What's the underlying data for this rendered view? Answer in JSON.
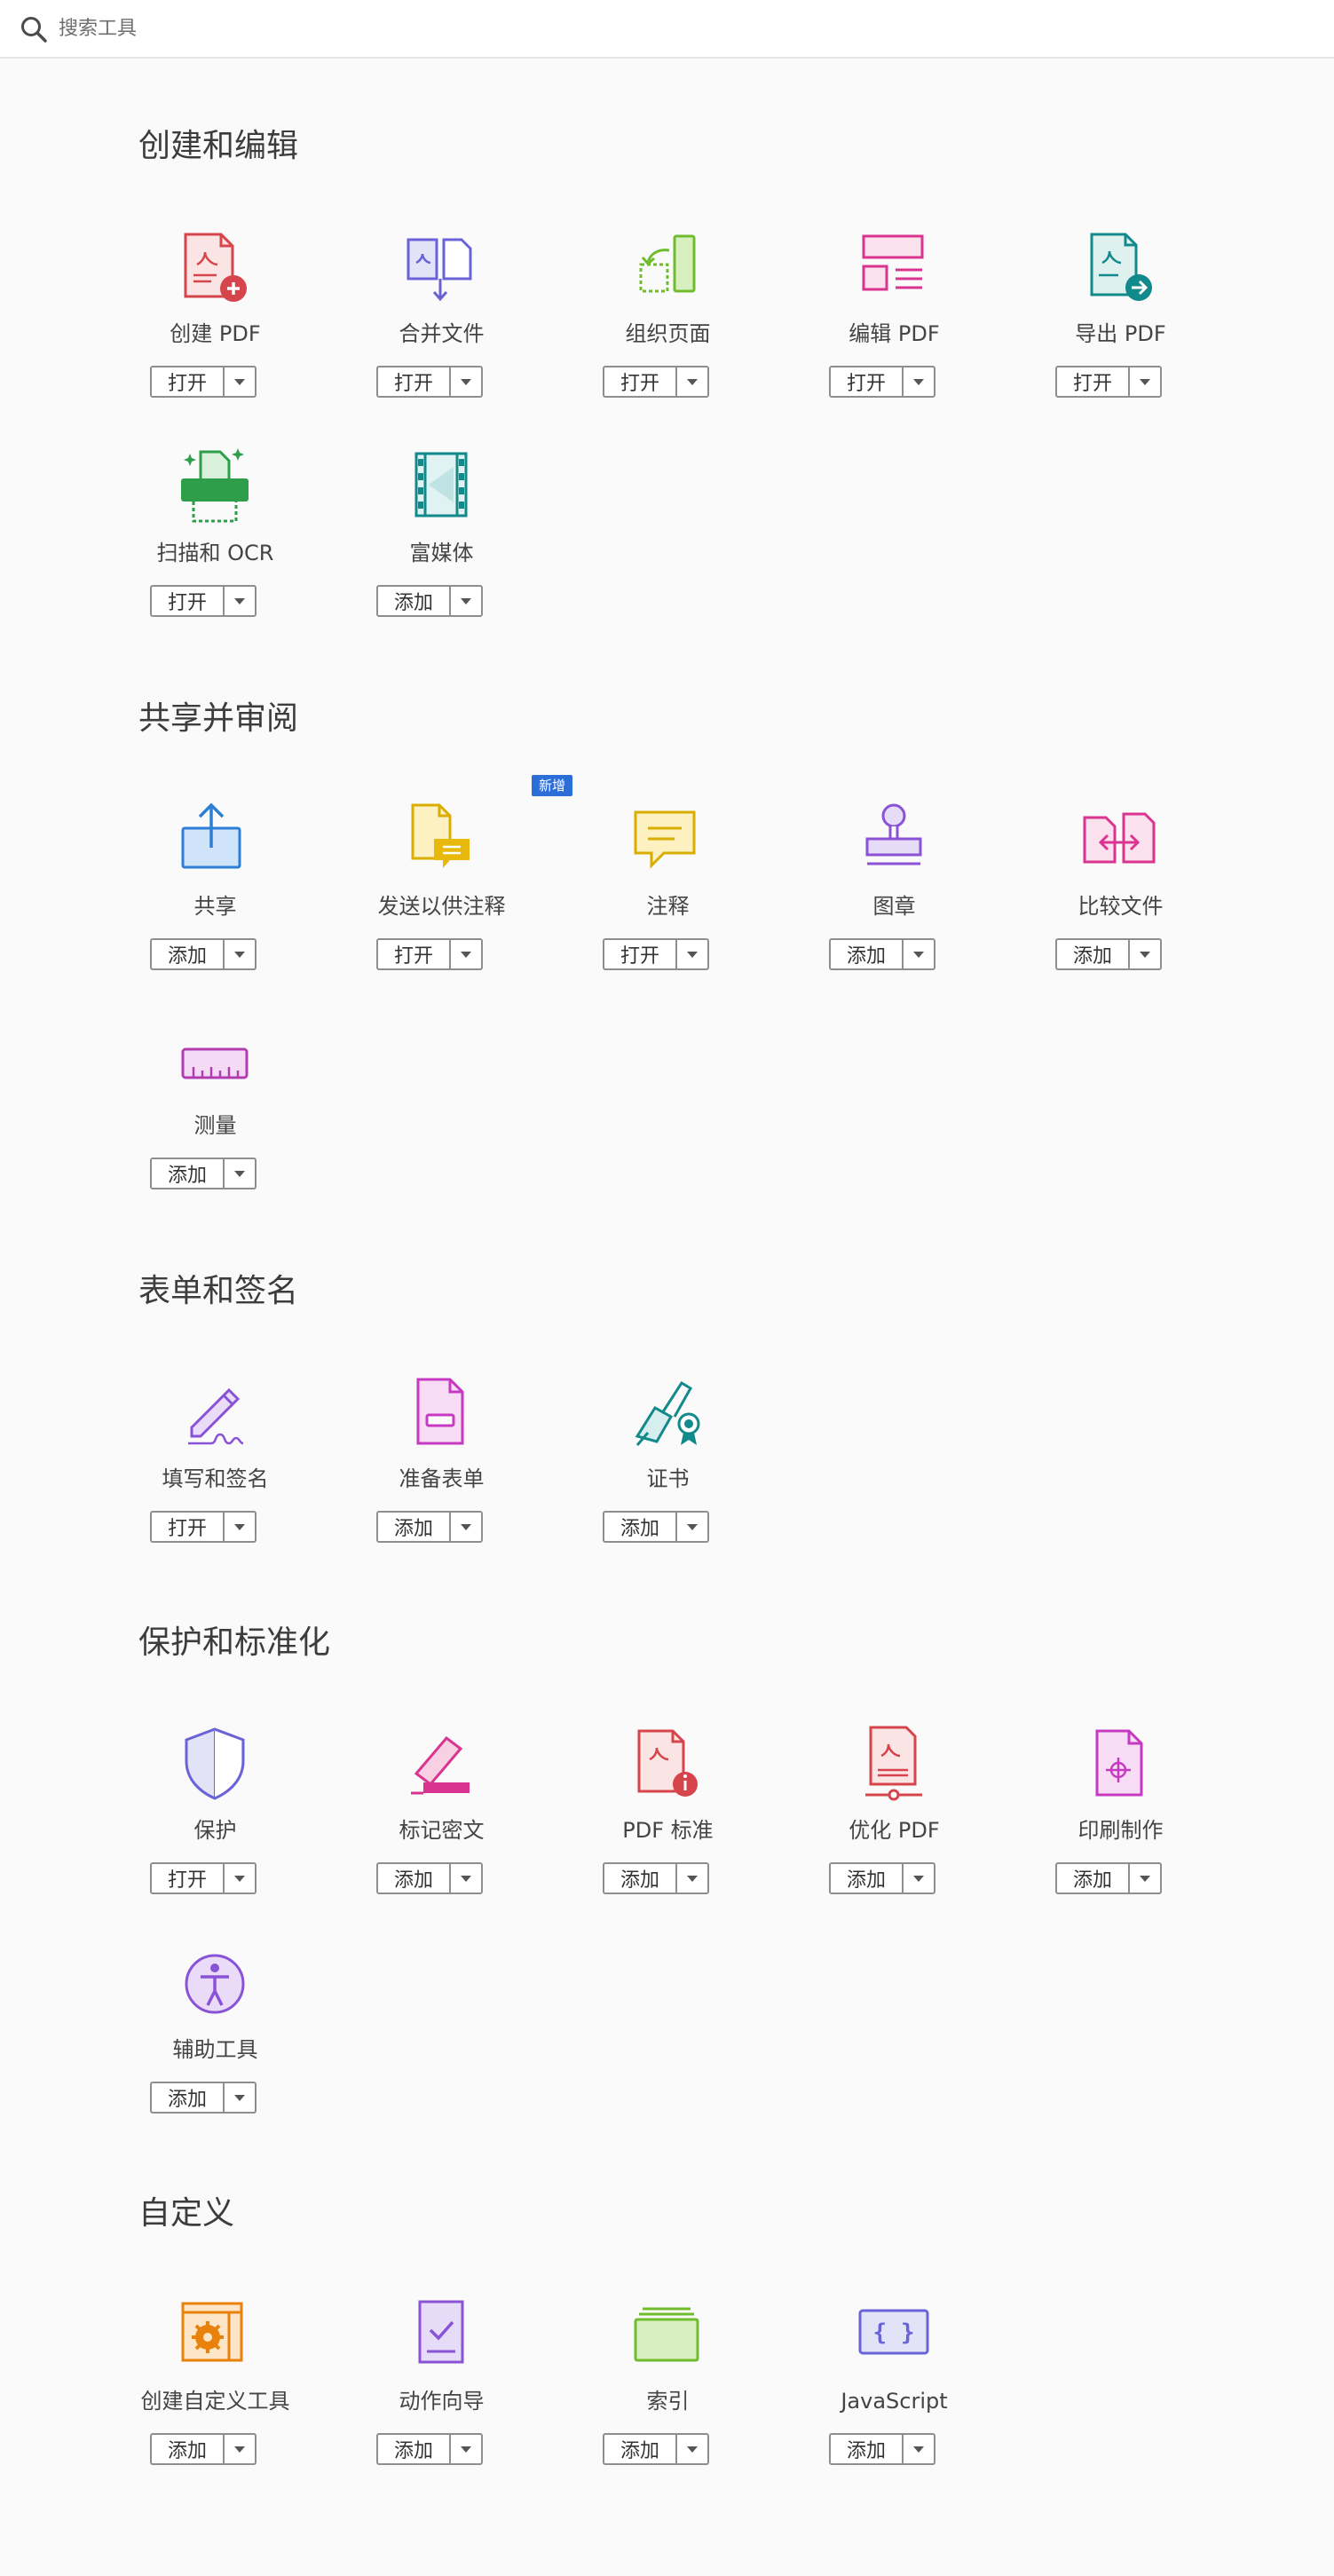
{
  "search": {
    "placeholder": "搜索工具"
  },
  "sections": [
    {
      "title": "创建和编辑",
      "tools": [
        {
          "label": "创建 PDF",
          "button": "打开",
          "icon": "create-pdf-icon"
        },
        {
          "label": "合并文件",
          "button": "打开",
          "icon": "combine-files-icon"
        },
        {
          "label": "组织页面",
          "button": "打开",
          "icon": "organize-pages-icon"
        },
        {
          "label": "编辑 PDF",
          "button": "打开",
          "icon": "edit-pdf-icon"
        },
        {
          "label": "导出 PDF",
          "button": "打开",
          "icon": "export-pdf-icon"
        },
        {
          "label": "扫描和 OCR",
          "button": "打开",
          "icon": "scan-ocr-icon"
        },
        {
          "label": "富媒体",
          "button": "添加",
          "icon": "rich-media-icon"
        }
      ]
    },
    {
      "title": "共享并审阅",
      "tools": [
        {
          "label": "共享",
          "button": "添加",
          "icon": "share-icon"
        },
        {
          "label": "发送以供注释",
          "button": "打开",
          "icon": "send-for-comments-icon",
          "badge": "新增"
        },
        {
          "label": "注释",
          "button": "打开",
          "icon": "comment-icon"
        },
        {
          "label": "图章",
          "button": "添加",
          "icon": "stamp-icon"
        },
        {
          "label": "比较文件",
          "button": "添加",
          "icon": "compare-files-icon"
        },
        {
          "label": "测量",
          "button": "添加",
          "icon": "measure-icon"
        }
      ]
    },
    {
      "title": "表单和签名",
      "tools": [
        {
          "label": "填写和签名",
          "button": "打开",
          "icon": "fill-sign-icon"
        },
        {
          "label": "准备表单",
          "button": "添加",
          "icon": "prepare-form-icon"
        },
        {
          "label": "证书",
          "button": "添加",
          "icon": "certificates-icon"
        }
      ]
    },
    {
      "title": "保护和标准化",
      "tools": [
        {
          "label": "保护",
          "button": "打开",
          "icon": "protect-icon"
        },
        {
          "label": "标记密文",
          "button": "添加",
          "icon": "redact-icon"
        },
        {
          "label": "PDF 标准",
          "button": "添加",
          "icon": "pdf-standards-icon"
        },
        {
          "label": "优化 PDF",
          "button": "添加",
          "icon": "optimize-pdf-icon"
        },
        {
          "label": "印刷制作",
          "button": "添加",
          "icon": "print-production-icon"
        },
        {
          "label": "辅助工具",
          "button": "添加",
          "icon": "accessibility-icon"
        }
      ]
    },
    {
      "title": "自定义",
      "tools": [
        {
          "label": "创建自定义工具",
          "button": "添加",
          "icon": "create-custom-tool-icon"
        },
        {
          "label": "动作向导",
          "button": "添加",
          "icon": "action-wizard-icon"
        },
        {
          "label": "索引",
          "button": "添加",
          "icon": "index-icon"
        },
        {
          "label": "JavaScript",
          "button": "添加",
          "icon": "javascript-icon"
        }
      ]
    }
  ]
}
